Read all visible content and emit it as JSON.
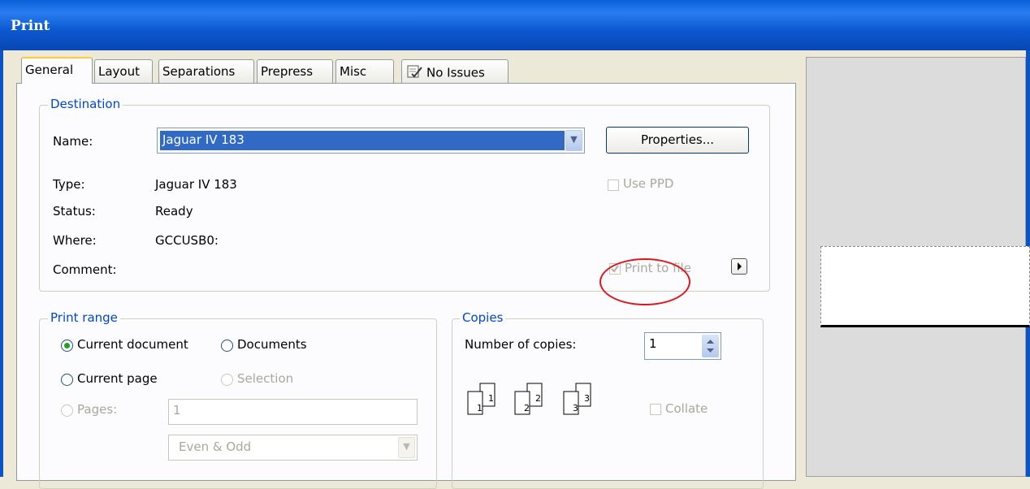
{
  "window": {
    "title": "Print"
  },
  "tabs": [
    {
      "label": "General"
    },
    {
      "label": "Layout"
    },
    {
      "label": "Separations"
    },
    {
      "label": "Prepress"
    },
    {
      "label": "Misc"
    },
    {
      "label": "No Issues"
    }
  ],
  "destination": {
    "group_label": "Destination",
    "name_label": "Name:",
    "name_value": "Jaguar IV 183",
    "properties_button": "Properties...",
    "type_label": "Type:",
    "type_value": "Jaguar IV 183",
    "status_label": "Status:",
    "status_value": "Ready",
    "where_label": "Where:",
    "where_value": "GCCUSB0:",
    "comment_label": "Comment:",
    "use_ppd_label": "Use PPD",
    "print_to_file_label": "Print to file"
  },
  "print_range": {
    "group_label": "Print range",
    "current_document": "Current document",
    "documents": "Documents",
    "current_page": "Current page",
    "selection": "Selection",
    "pages_label": "Pages:",
    "pages_value": "1",
    "even_odd_value": "Even & Odd"
  },
  "copies": {
    "group_label": "Copies",
    "number_label": "Number of copies:",
    "number_value": "1",
    "collate_label": "Collate",
    "collate_pages": [
      "1",
      "1",
      "2",
      "2",
      "3",
      "3"
    ]
  },
  "colors": {
    "title_bar": "#0a5fd8",
    "highlight": "#316ac5",
    "annotation": "#e0141c",
    "group_label": "#0046d5"
  }
}
